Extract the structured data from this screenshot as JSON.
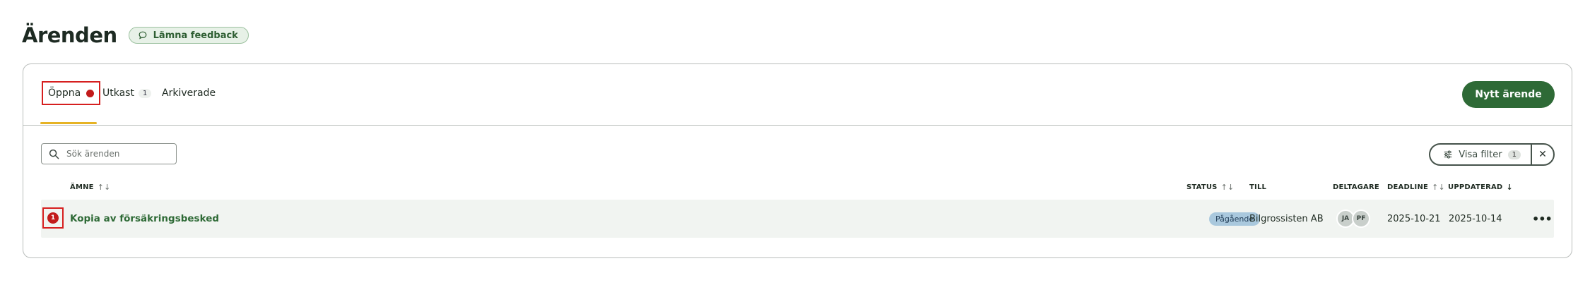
{
  "header": {
    "title": "Ärenden",
    "feedback_label": "Lämna feedback"
  },
  "tabs": [
    {
      "label": "Öppna",
      "has_alert": true,
      "selected": true
    },
    {
      "label": "Utkast",
      "count": "1"
    },
    {
      "label": "Arkiverade"
    }
  ],
  "toolbar": {
    "new_label": "Nytt ärende",
    "search_placeholder": "Sök ärenden",
    "filter_label": "Visa filter",
    "filter_count": "1",
    "clear_symbol": "✕"
  },
  "table": {
    "columns": {
      "subject": "ÄMNE",
      "status": "STATUS",
      "to": "TILL",
      "participants": "DELTAGARE",
      "deadline": "DEADLINE",
      "updated": "UPPDATERAD"
    },
    "rows": [
      {
        "alert_count": "1",
        "subject": "Kopia av försäkringsbesked",
        "status": "Pågående",
        "to": "Bilgrossisten AB",
        "participants": [
          "JA",
          "PF"
        ],
        "deadline": "2025-10-21",
        "updated": "2025-10-14",
        "actions": "•••"
      }
    ]
  },
  "colors": {
    "brand_green": "#2e6a36",
    "alert_red": "#c21b1b",
    "tab_underline": "#e6b325",
    "status_blue": "#a9c8dd"
  },
  "icons": [
    "chat-bubble-icon",
    "search-icon",
    "filter-sliders-icon",
    "close-icon",
    "sort-icon",
    "sort-down-icon",
    "more-icon"
  ]
}
